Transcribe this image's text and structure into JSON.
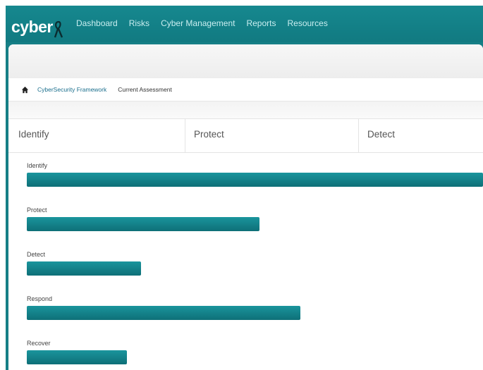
{
  "brand": {
    "name": "cyber"
  },
  "nav": {
    "items": [
      "Dashboard",
      "Risks",
      "Cyber Management",
      "Reports",
      "Resources"
    ]
  },
  "breadcrumb": {
    "link": "CyberSecurity Framework",
    "current": "Current Assessment"
  },
  "tabs": [
    "Identify",
    "Protect",
    "Detect"
  ],
  "chart_data": {
    "type": "bar",
    "orientation": "horizontal",
    "categories": [
      "Identify",
      "Protect",
      "Detect",
      "Respond",
      "Recover"
    ],
    "values": [
      100,
      51,
      25,
      60,
      22
    ],
    "xlim": [
      0,
      100
    ]
  },
  "colors": {
    "nav_bg": "#117a81",
    "bar": "#12828a",
    "link": "#1b6f8d"
  }
}
